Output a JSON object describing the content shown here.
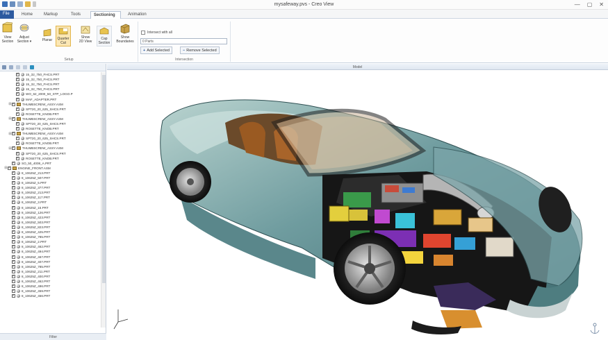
{
  "window": {
    "title": "mysafeway.pvs - Creo View",
    "controls": [
      "—",
      "▢",
      "✕"
    ]
  },
  "quick_access": [
    "app-icon",
    "save-icon",
    "undo-icon",
    "folder-icon",
    "dropdown-icon"
  ],
  "ribbon": {
    "tabs": [
      {
        "label": "File",
        "kind": "file"
      },
      {
        "label": "Home"
      },
      {
        "label": "Markup"
      },
      {
        "label": "Tools"
      },
      {
        "label": "Sectioning",
        "active": true
      },
      {
        "label": "Animation"
      }
    ],
    "setup_group": {
      "label": "Setup",
      "buttons": [
        {
          "label1": "View",
          "label2": "Section",
          "icon": "view-section-icon"
        },
        {
          "label1": "Adjust",
          "label2": "Section ▾",
          "icon": "adjust-section-icon"
        },
        {
          "label1": "Planar",
          "label2": "",
          "icon": "planar-icon"
        },
        {
          "label1": "Quarter",
          "label2": "Cut",
          "icon": "quarter-cut-icon"
        },
        {
          "label1": "Show",
          "label2": "2D View",
          "icon": "show-2d-view-icon"
        },
        {
          "label1": "Cap",
          "label2": "Section",
          "icon": "cap-section-icon"
        },
        {
          "label1": "Show",
          "label2": "Boundaries",
          "icon": "show-boundaries-icon"
        }
      ]
    },
    "intersection_group": {
      "label": "Intersection",
      "intersect_label": "Intersect with all",
      "parts_value": "0 Parts",
      "add_selected": "Add Selected",
      "remove_selected": "Remove Selected"
    }
  },
  "left_panel": {
    "footer": "Filter",
    "tree": [
      {
        "indent": 3,
        "type": "part",
        "label": "15_32_750_FHCS.PRT"
      },
      {
        "indent": 3,
        "type": "part",
        "label": "15_32_750_FHCS.PRT"
      },
      {
        "indent": 3,
        "type": "part",
        "label": "15_32_750_FHCS.PRT"
      },
      {
        "indent": 3,
        "type": "part",
        "label": "15_32_750_FHCS.PRT"
      },
      {
        "indent": 3,
        "type": "part",
        "label": "WO_62_2000_50_STP_LOGO.P"
      },
      {
        "indent": 3,
        "type": "part",
        "label": "MAF_ADAPTER.PRT"
      },
      {
        "indent": 2,
        "type": "asm",
        "expand": "⊟",
        "label": "THUMBSCREW_ASSY.ASM"
      },
      {
        "indent": 3,
        "type": "part",
        "label": "SPT20_20_625_SHCS.PRT"
      },
      {
        "indent": 3,
        "type": "part",
        "label": "ROSETTE_KNOB.PRT"
      },
      {
        "indent": 2,
        "type": "asm",
        "expand": "⊟",
        "label": "THUMBSCREW_ASSY.ASM"
      },
      {
        "indent": 3,
        "type": "part",
        "label": "SPT20_20_625_SHCS.PRT"
      },
      {
        "indent": 3,
        "type": "part",
        "label": "ROSETTE_KNOB.PRT"
      },
      {
        "indent": 2,
        "type": "asm",
        "expand": "⊟",
        "label": "THUMBSCREW_ASSY.ASM"
      },
      {
        "indent": 3,
        "type": "part",
        "label": "SPT20_20_625_SHCS.PRT"
      },
      {
        "indent": 3,
        "type": "part",
        "label": "ROSETTE_KNOB.PRT"
      },
      {
        "indent": 2,
        "type": "asm",
        "expand": "⊟",
        "label": "THUMBSCREW_ASSY.ASM"
      },
      {
        "indent": 3,
        "type": "part",
        "label": "SPT20_20_625_SHCS.PRT"
      },
      {
        "indent": 3,
        "type": "part",
        "label": "ROSETTE_KNOB.PRT"
      },
      {
        "indent": 2,
        "type": "part",
        "label": "SO_50_4008_A.PRT"
      },
      {
        "indent": 1,
        "type": "asm",
        "expand": "⊟",
        "label": "ENGINE_FRONT.ASM"
      },
      {
        "indent": 2,
        "type": "part",
        "label": "8_10625Z_213.PRT"
      },
      {
        "indent": 2,
        "type": "part",
        "label": "8_10625Z_507.PRT"
      },
      {
        "indent": 2,
        "type": "part",
        "label": "8_10625Z_5.PRT"
      },
      {
        "indent": 2,
        "type": "part",
        "label": "8_10625Z_377.PRT"
      },
      {
        "indent": 2,
        "type": "part",
        "label": "8_10625Z_213.PRT"
      },
      {
        "indent": 2,
        "type": "part",
        "label": "8_10625Z_117.PRT"
      },
      {
        "indent": 2,
        "type": "part",
        "label": "8_10625Z_3.PRT"
      },
      {
        "indent": 2,
        "type": "part",
        "label": "8_10625Z_15.PRT"
      },
      {
        "indent": 2,
        "type": "part",
        "label": "8_10625Z_126.PRT"
      },
      {
        "indent": 2,
        "type": "part",
        "label": "8_10625Z_423.PRT"
      },
      {
        "indent": 2,
        "type": "part",
        "label": "8_10625Z_503.PRT"
      },
      {
        "indent": 2,
        "type": "part",
        "label": "8_10625Z_823.PRT"
      },
      {
        "indent": 2,
        "type": "part",
        "label": "8_10625Z_425.PRT"
      },
      {
        "indent": 2,
        "type": "part",
        "label": "8_10625Z_785.PRT"
      },
      {
        "indent": 2,
        "type": "part",
        "label": "8_10625Z_2.PRT"
      },
      {
        "indent": 2,
        "type": "part",
        "label": "8_10625Z_462.PRT"
      },
      {
        "indent": 2,
        "type": "part",
        "label": "8_10625Z_494.PRT"
      },
      {
        "indent": 2,
        "type": "part",
        "label": "8_10625Z_467.PRT"
      },
      {
        "indent": 2,
        "type": "part",
        "label": "8_10625Z_407.PRT"
      },
      {
        "indent": 2,
        "type": "part",
        "label": "8_10625Z_785.PRT"
      },
      {
        "indent": 2,
        "type": "part",
        "label": "8_10625Z_211.PRT"
      },
      {
        "indent": 2,
        "type": "part",
        "label": "8_10625Z_400.PRT"
      },
      {
        "indent": 2,
        "type": "part",
        "label": "8_10625Z_462.PRT"
      },
      {
        "indent": 2,
        "type": "part",
        "label": "8_10625Z_496.PRT"
      },
      {
        "indent": 2,
        "type": "part",
        "label": "8_10625Z_459.PRT"
      },
      {
        "indent": 2,
        "type": "part",
        "label": "8_10625Z_456.PRT"
      }
    ]
  },
  "viewport": {
    "header": "Model",
    "model_color": "#6f9c9f",
    "accent": "#2c5aa0"
  }
}
